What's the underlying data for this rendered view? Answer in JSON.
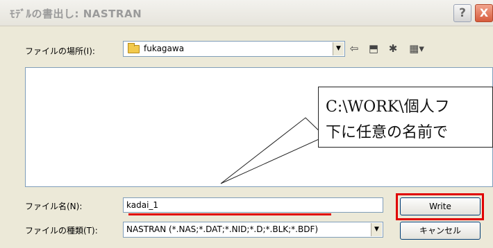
{
  "window": {
    "title": "ﾓﾃﾞﾙの書出し: NASTRAN",
    "help_label": "?",
    "close_label": "X"
  },
  "location": {
    "label": "ファイルの場所(I):",
    "folder": "fukagawa"
  },
  "toolbar": {
    "back_icon": "back-arrow-icon",
    "up_icon": "up-folder-icon",
    "new_folder_icon": "new-folder-icon",
    "view_icon": "view-menu-icon"
  },
  "callout": {
    "line1": "C:\\WORK\\個人フ",
    "line2": "下に任意の名前で"
  },
  "filename": {
    "label": "ファイル名(N):",
    "value": "kadai_1"
  },
  "filetype": {
    "label": "ファイルの種類(T):",
    "value": "NASTRAN (*.NAS;*.DAT;*.NID;*.D;*.BLK;*.BDF)"
  },
  "buttons": {
    "write_label": "Write",
    "cancel_label": "キャンセル"
  },
  "colors": {
    "highlight_red": "#e00000",
    "titlebar_text": "#9a9a9a",
    "close_button": "#d65b3c"
  }
}
